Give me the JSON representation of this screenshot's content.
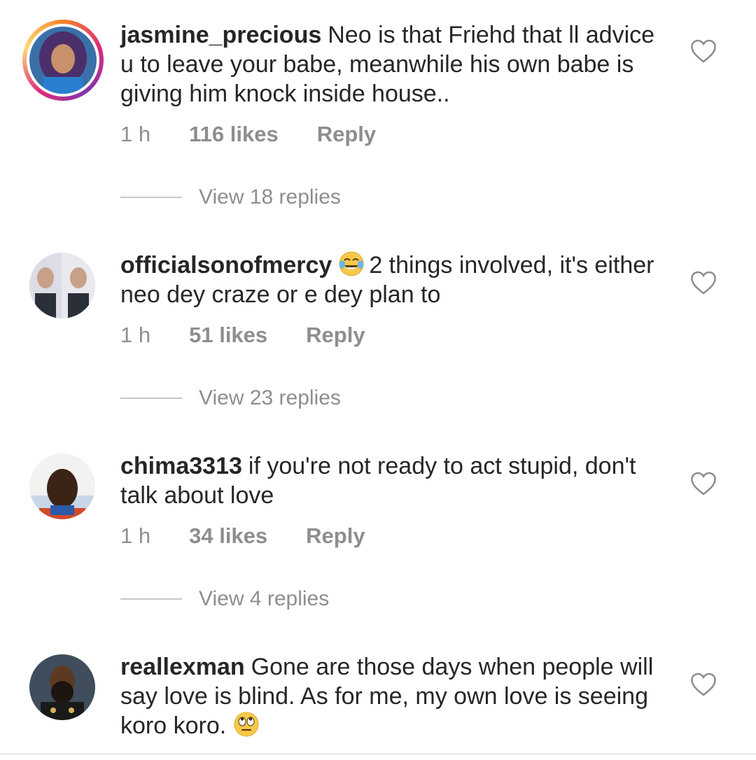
{
  "comments": [
    {
      "username": "jasmine_precious",
      "text": "Neo is that Friehd that ll advice u to leave your babe, meanwhile his own babe is giving him knock inside house..",
      "time": "1 h",
      "likes": "116 likes",
      "reply_label": "Reply",
      "view_replies": "View 18 replies"
    },
    {
      "username": "officialsonofmercy",
      "emoji": "face-with-tears-of-joy",
      "text": "2 things involved, it's either neo dey craze or e dey plan to",
      "time": "1 h",
      "likes": "51 likes",
      "reply_label": "Reply",
      "view_replies": "View 23 replies"
    },
    {
      "username": "chima3313",
      "text": "if you're not ready to act stupid, don't talk about love",
      "time": "1 h",
      "likes": "34 likes",
      "reply_label": "Reply",
      "view_replies": "View 4 replies"
    },
    {
      "username": "reallexman",
      "text": "Gone are those days when people will say love is blind. As for me, my own love is seeing koro koro.",
      "emoji_trailing": "face-with-rolling-eyes"
    }
  ],
  "colors": {
    "text": "#262626",
    "secondary": "#8e8e8e",
    "divider": "#c7c7c7",
    "story_ring": "#dd2a7b"
  },
  "icons": {
    "like": "heart-outline-icon"
  }
}
